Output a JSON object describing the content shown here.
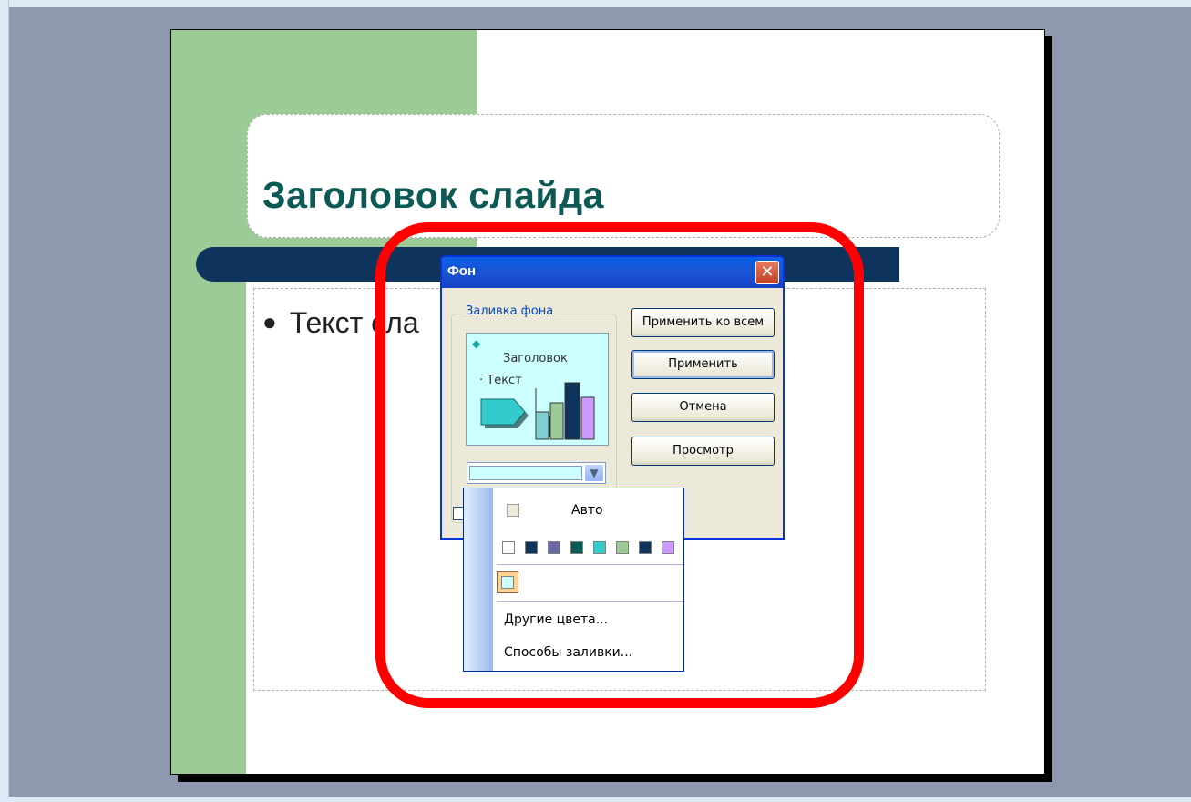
{
  "slide": {
    "title": "Заголовок слайда",
    "bullet": "Текст сла"
  },
  "dialog": {
    "title": "Фон",
    "group_label": "Заливка фона",
    "preview": {
      "title": "Заголовок",
      "bullet": "Текст"
    },
    "buttons": {
      "apply_all": "Применить ко всем",
      "apply": "Применить",
      "cancel": "Отмена",
      "preview": "Просмотр"
    }
  },
  "color_popup": {
    "auto_label": "Авто",
    "swatches": [
      "#ffffff",
      "#0e345e",
      "#6a6aa0",
      "#0c5a55",
      "#33cccc",
      "#9ccb97",
      "#0e345e",
      "#cc99ff"
    ],
    "selected_color": "#ccffff",
    "more_colors": "Другие цвета...",
    "fill_effects": "Способы заливки..."
  },
  "colors": {
    "highlight": "#ff0000",
    "workspace": "#8e98ae",
    "slide_green": "#9ccb97",
    "slide_navy": "#0e345e"
  }
}
